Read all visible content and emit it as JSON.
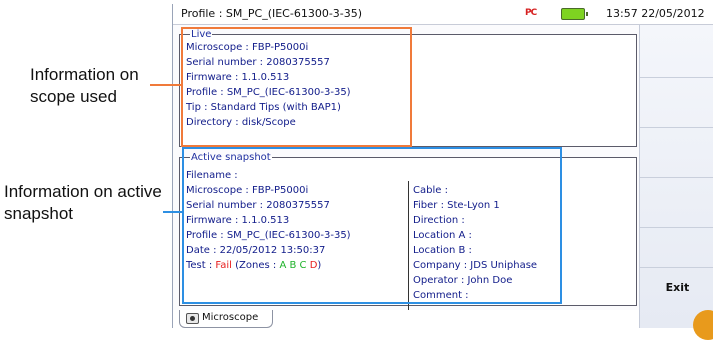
{
  "annotations": {
    "scope_label": "Information on scope used",
    "snapshot_label": "Information on active snapshot"
  },
  "titlebar": {
    "title": "Profile : SM_PC_(IEC-61300-3-35)",
    "status_icon_text": "PC",
    "clock": "13:57 22/05/2012"
  },
  "live": {
    "legend": "Live",
    "lines": [
      "Microscope : FBP-P5000i",
      "Serial number : 2080375557",
      "Firmware : 1.1.0.513",
      "Profile : SM_PC_(IEC-61300-3-35)",
      "Tip : Standard Tips (with BAP1)",
      "Directory : disk/Scope"
    ]
  },
  "snapshot": {
    "legend": "Active snapshot",
    "left_lines": [
      "Filename :",
      "Microscope : FBP-P5000i",
      "Serial number : 2080375557",
      "Firmware : 1.1.0.513",
      "Profile : SM_PC_(IEC-61300-3-35)",
      "Date : 22/05/2012 13:50:37"
    ],
    "test": {
      "prefix": "Test : ",
      "result": "Fail",
      "zones_prefix": " (Zones : ",
      "zone_a": "A",
      "zone_b": "B",
      "zone_c": "C",
      "zone_d": "D",
      "zones_suffix": ")"
    },
    "right_lines": [
      "Cable :",
      "Fiber : Ste-Lyon 1",
      "Direction :",
      "Location A :",
      "Location B :",
      "Company : JDS Uniphase",
      "Operator : John Doe",
      "Comment :"
    ]
  },
  "sidebar": {
    "exit_label": "Exit"
  },
  "tabs": [
    {
      "label": "Microscope"
    }
  ],
  "colors": {
    "highlight_orange": "#f07a3a",
    "highlight_blue": "#2d8fe3",
    "fail": "#e81e1e",
    "zone_pass": "#1fb22a",
    "zone_fail": "#e81e1e",
    "text_blue": "#111c8a"
  }
}
